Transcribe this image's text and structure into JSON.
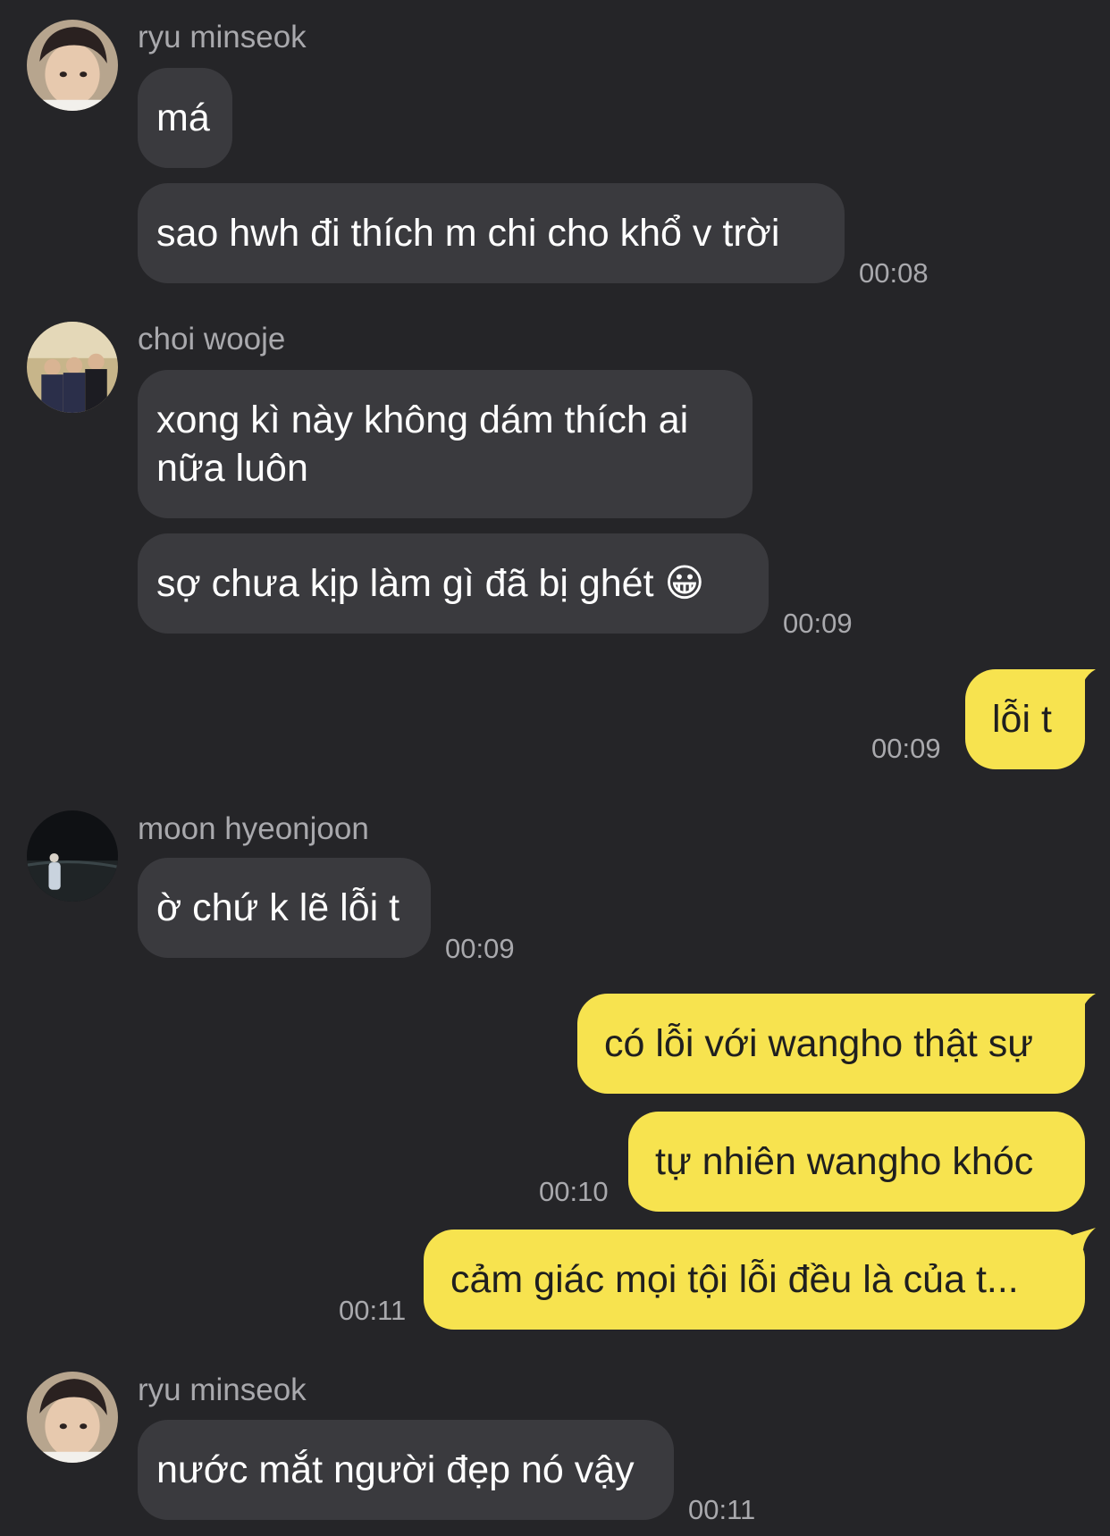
{
  "theme": {
    "background": "#252528",
    "incoming_bubble": "#3a3a3e",
    "outgoing_bubble": "#f7e34f",
    "secondary_text": "#a9a9ad"
  },
  "messages": [
    {
      "sender": "ryu minseok",
      "text": "má"
    },
    {
      "text": "sao hwh đi thích m chi cho khổ v trời",
      "time": "00:08"
    },
    {
      "sender": "choi wooje",
      "lines": [
        "xong kì này không dám thích ai",
        "nữa luôn"
      ]
    },
    {
      "text": "sợ chưa kịp làm gì đã bị ghét 😀",
      "time": "00:09"
    },
    {
      "text": "lỗi t",
      "time": "00:09"
    },
    {
      "sender": "moon hyeonjoon",
      "text": "ờ chứ k lẽ lỗi t",
      "time": "00:09"
    },
    {
      "text": "có lỗi với wangho thật sự"
    },
    {
      "text": "tự nhiên wangho khóc",
      "time": "00:10"
    },
    {
      "text": "cảm giác mọi tội lỗi đều là của t...",
      "time": "00:11"
    },
    {
      "sender": "ryu minseok",
      "text": "nước mắt người đẹp nó vậy",
      "time": "00:11"
    }
  ]
}
